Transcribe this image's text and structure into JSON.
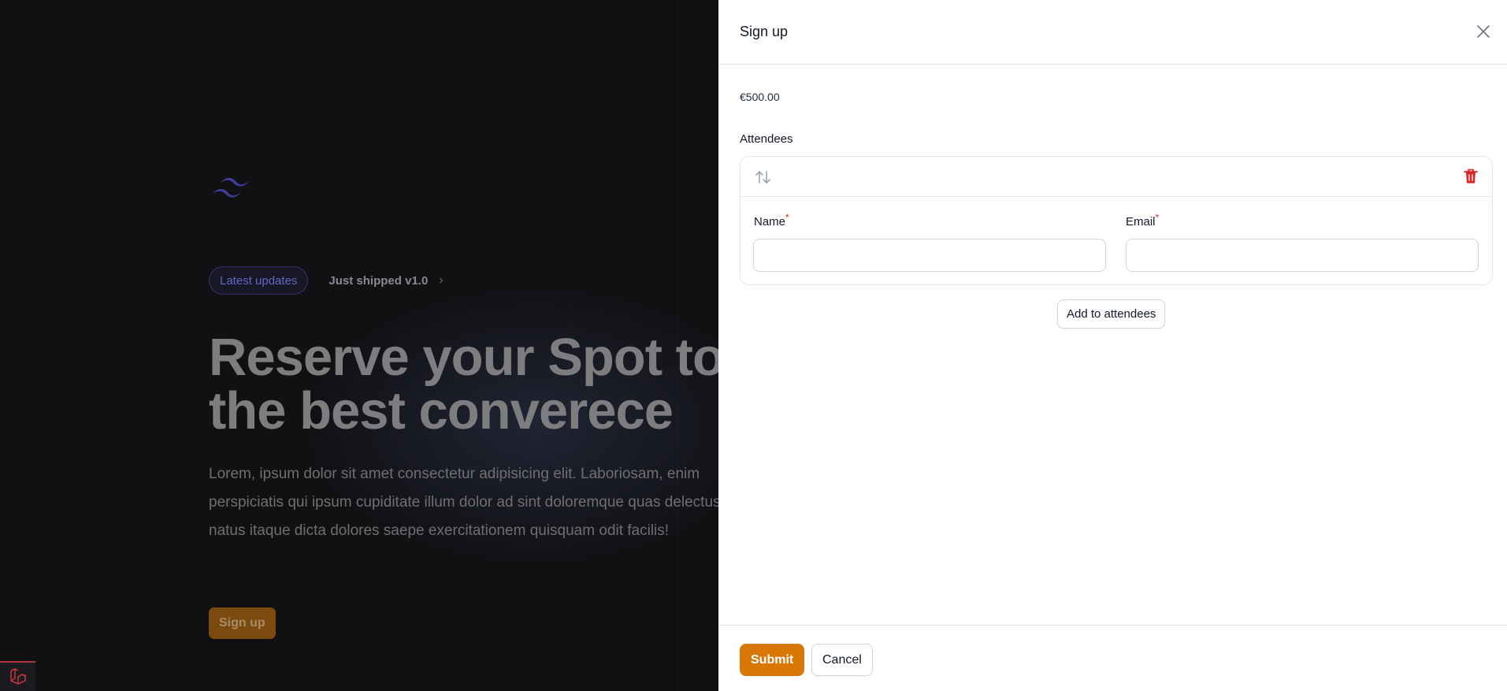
{
  "landing": {
    "badge_label": "Latest updates",
    "shipped_label": "Just shipped v1.0",
    "hero_title": "Reserve your Spot to\nthe best converece",
    "hero_text": "Lorem, ipsum dolor sit amet consectetur adipisicing elit. Laboriosam, enim perspiciatis qui ipsum cupiditate illum dolor ad sint doloremque quas delectus natus itaque dicta dolores saepe exercitationem quisquam odit facilis!",
    "signup_label": "Sign up",
    "logo_icon": "tailwind-logo-icon",
    "dev_icon": "laravel-logo-icon"
  },
  "modal": {
    "title": "Sign up",
    "close_icon": "close-icon",
    "price": "€500.00",
    "attendees_label": "Attendees",
    "repeater": {
      "reorder_icon": "reorder-icon",
      "delete_icon": "trash-icon",
      "fields": {
        "name_label": "Name",
        "email_label": "Email",
        "required_marker": "*"
      }
    },
    "add_button": "Add to attendees",
    "submit_label": "Submit",
    "cancel_label": "Cancel"
  },
  "colors": {
    "accent": "#d97706",
    "danger": "#dc2626",
    "brand_indigo": "#6366f1"
  }
}
